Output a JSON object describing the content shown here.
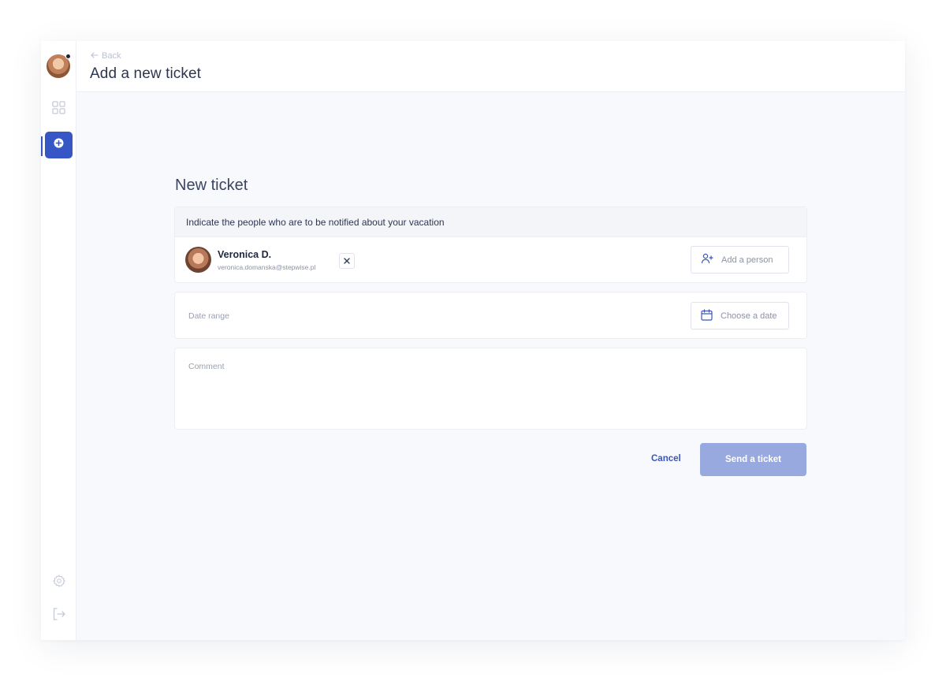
{
  "header": {
    "back_label": "Back",
    "title": "Add a new ticket"
  },
  "form": {
    "title": "New ticket",
    "notify": {
      "heading": "Indicate the people who are to be notified about your vacation",
      "people": [
        {
          "name": "Veronica D.",
          "email": "veronica.domanska@stepwise.pl"
        }
      ],
      "add_person_label": "Add a person"
    },
    "date": {
      "label": "Date range",
      "button_label": "Choose a date"
    },
    "comment": {
      "placeholder": "Comment"
    },
    "actions": {
      "cancel_label": "Cancel",
      "send_label": "Send a ticket"
    }
  },
  "colors": {
    "accent": "#3656c5",
    "send_disabled": "#98a9df",
    "background": "#f8f9fc"
  }
}
